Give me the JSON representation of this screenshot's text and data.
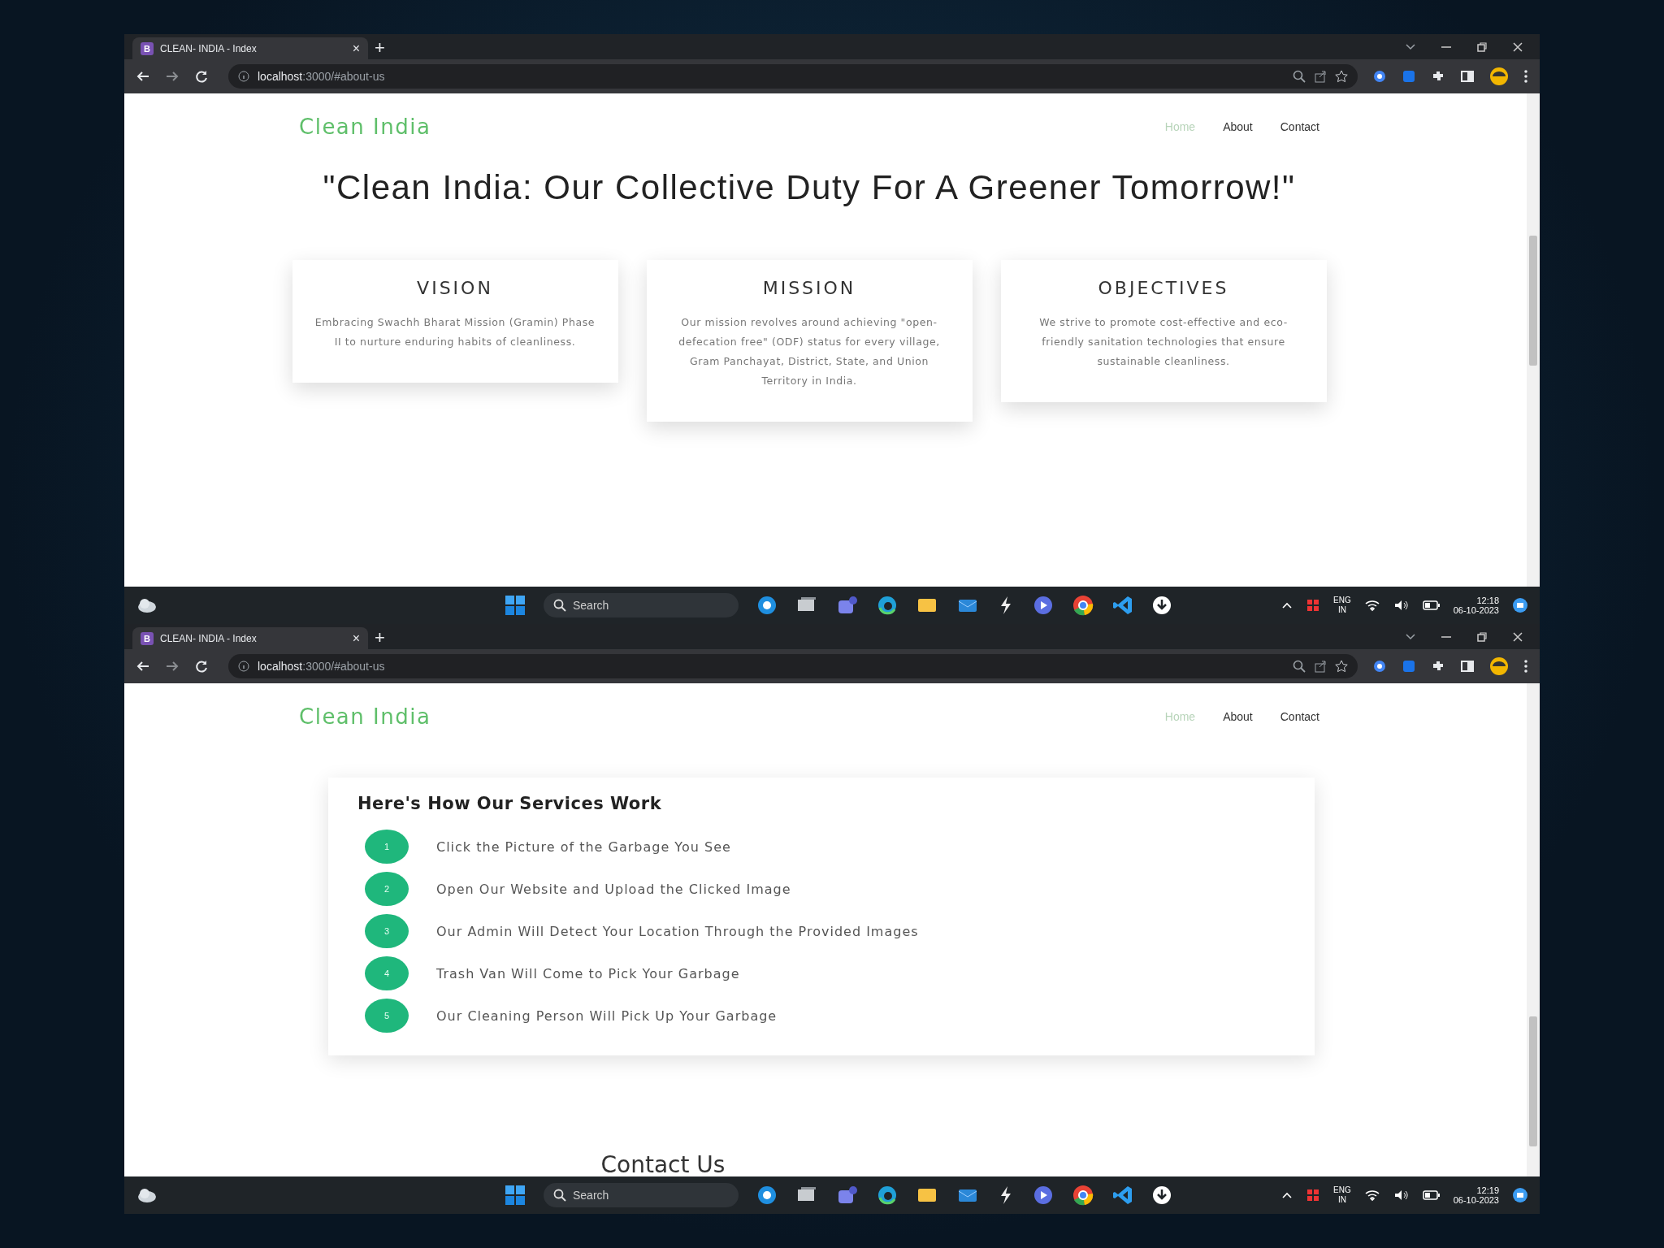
{
  "screens": [
    {
      "tab": {
        "favicon": "B",
        "title": "CLEAN- INDIA - Index",
        "close": "×",
        "new_tab": "+"
      },
      "url": {
        "host": "localhost",
        "path": ":3000/#about-us"
      },
      "site": {
        "logo": "Clean India",
        "nav": [
          {
            "label": "Home",
            "selected": true
          },
          {
            "label": "About",
            "selected": false
          },
          {
            "label": "Contact",
            "selected": false
          }
        ]
      },
      "content": {
        "kind": "about",
        "headline": "\"Clean India: Our Collective Duty For A Greener Tomorrow!\"",
        "cards": [
          {
            "title": "VISION",
            "text": "Embracing Swachh Bharat Mission (Gramin) Phase II to nurture enduring habits of cleanliness."
          },
          {
            "title": "MISSION",
            "text": "Our mission revolves around achieving \"open-defecation free\" (ODF) status for every village, Gram Panchayat, District, State, and Union Territory in India."
          },
          {
            "title": "OBJECTIVES",
            "text": "We strive to promote cost-effective and eco-friendly sanitation technologies that ensure sustainable cleanliness."
          }
        ]
      },
      "taskbar": {
        "search": {
          "placeholder": "Search"
        },
        "language": "ENG",
        "region": "IN",
        "time": "12:18",
        "date": "06-10-2023"
      }
    },
    {
      "tab": {
        "favicon": "B",
        "title": "CLEAN- INDIA - Index",
        "close": "×",
        "new_tab": "+"
      },
      "url": {
        "host": "localhost",
        "path": ":3000/#about-us"
      },
      "site": {
        "logo": "Clean India",
        "nav": [
          {
            "label": "Home",
            "selected": true
          },
          {
            "label": "About",
            "selected": false
          },
          {
            "label": "Contact",
            "selected": false
          }
        ]
      },
      "content": {
        "kind": "services",
        "heading": "Here's How Our Services Work",
        "steps": [
          {
            "number": "1",
            "text": "Click the Picture of the Garbage You See"
          },
          {
            "number": "2",
            "text": "Open Our Website and Upload the Clicked Image"
          },
          {
            "number": "3",
            "text": "Our Admin Will Detect Your Location Through the Provided Images"
          },
          {
            "number": "4",
            "text": "Trash Van Will Come to Pick Your Garbage"
          },
          {
            "number": "5",
            "text": "Our Cleaning Person Will Pick Up Your Garbage"
          }
        ],
        "next_heading": "Contact Us"
      },
      "taskbar": {
        "search": {
          "placeholder": "Search"
        },
        "language": "ENG",
        "region": "IN",
        "time": "12:19",
        "date": "06-10-2023"
      }
    }
  ]
}
